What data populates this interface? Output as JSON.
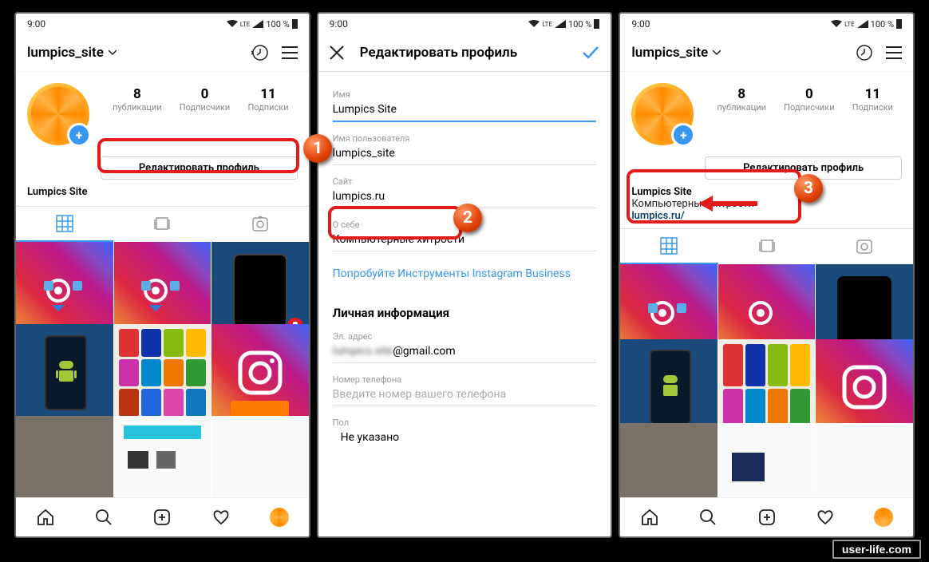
{
  "status": {
    "time": "9:00",
    "net": "LTE",
    "battery": "100 %"
  },
  "screenA": {
    "username": "lumpics_site",
    "stats": {
      "posts": {
        "n": "8",
        "l": "публикации"
      },
      "followers": {
        "n": "0",
        "l": "Подписчики"
      },
      "following": {
        "n": "11",
        "l": "Подписки"
      }
    },
    "edit_btn": "Редактировать профиль",
    "display_name": "Lumpics Site"
  },
  "screenB": {
    "title": "Редактировать профиль",
    "name_lbl": "Имя",
    "name_val": "Lumpics Site",
    "user_lbl": "Имя пользователя",
    "user_val": "lumpics_site",
    "site_lbl": "Сайт",
    "site_val": "lumpics.ru",
    "bio_lbl": "О себе",
    "bio_val": "Компьютерные хитрости",
    "biz_link": "Попробуйте Инструменты Instagram Business",
    "priv_title": "Личная информация",
    "email_lbl": "Эл. адрес",
    "email_val": "@gmail.com",
    "phone_lbl": "Номер телефона",
    "phone_ph": "Введите номер вашего телефона",
    "gender_lbl": "Пол",
    "gender_val": "Не указано"
  },
  "screenC": {
    "username": "lumpics_site",
    "stats": {
      "posts": {
        "n": "8",
        "l": "публикации"
      },
      "followers": {
        "n": "0",
        "l": "Подписчики"
      },
      "following": {
        "n": "11",
        "l": "Подписки"
      }
    },
    "edit_btn": "Редактировать профиль",
    "display_name": "Lumpics Site",
    "bio": "Компьютерные хитрости",
    "site": "lumpics.ru/"
  },
  "markers": {
    "m1": "1",
    "m2": "2",
    "m3": "3"
  },
  "watermark": "user-life.com"
}
